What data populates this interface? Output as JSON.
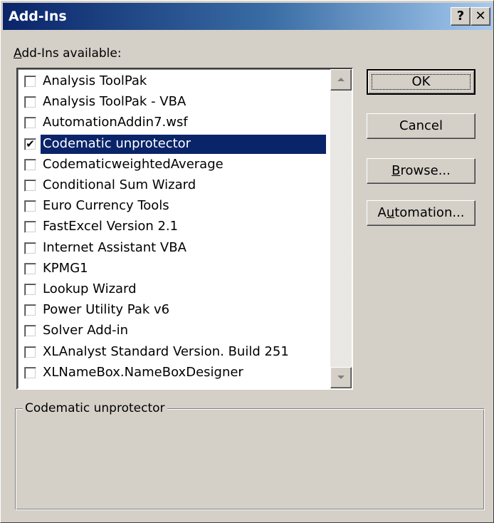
{
  "window": {
    "title": "Add-Ins",
    "help_label": "?",
    "close_label": "✕"
  },
  "list": {
    "label_prefix": "",
    "label_mnemonic": "A",
    "label_rest": "dd-Ins available:",
    "items": [
      {
        "label": "Analysis ToolPak",
        "checked": false
      },
      {
        "label": "Analysis ToolPak - VBA",
        "checked": false
      },
      {
        "label": "AutomationAddin7.wsf",
        "checked": false
      },
      {
        "label": "Codematic unprotector",
        "checked": true,
        "selected": true
      },
      {
        "label": "CodematicweightedAverage",
        "checked": false
      },
      {
        "label": "Conditional Sum Wizard",
        "checked": false
      },
      {
        "label": "Euro Currency Tools",
        "checked": false
      },
      {
        "label": "FastExcel Version 2.1",
        "checked": false
      },
      {
        "label": "Internet Assistant VBA",
        "checked": false
      },
      {
        "label": "KPMG1",
        "checked": false
      },
      {
        "label": "Lookup Wizard",
        "checked": false
      },
      {
        "label": "Power Utility Pak v6",
        "checked": false
      },
      {
        "label": "Solver Add-in",
        "checked": false
      },
      {
        "label": "XLAnalyst Standard Version. Build 251",
        "checked": false
      },
      {
        "label": "XLNameBox.NameBoxDesigner",
        "checked": false
      }
    ]
  },
  "buttons": {
    "ok": "OK",
    "cancel": "Cancel",
    "browse_mnemonic": "B",
    "browse_rest": "rowse...",
    "automation_prefix": "A",
    "automation_mnemonic": "u",
    "automation_rest": "tomation..."
  },
  "description": {
    "title": "Codematic unprotector",
    "text": ""
  },
  "icons": {
    "check": "✔"
  },
  "colors": {
    "titlebar_start": "#0a246a",
    "titlebar_end": "#a6caf0",
    "selection": "#0a246a",
    "face": "#d4d0c8"
  }
}
